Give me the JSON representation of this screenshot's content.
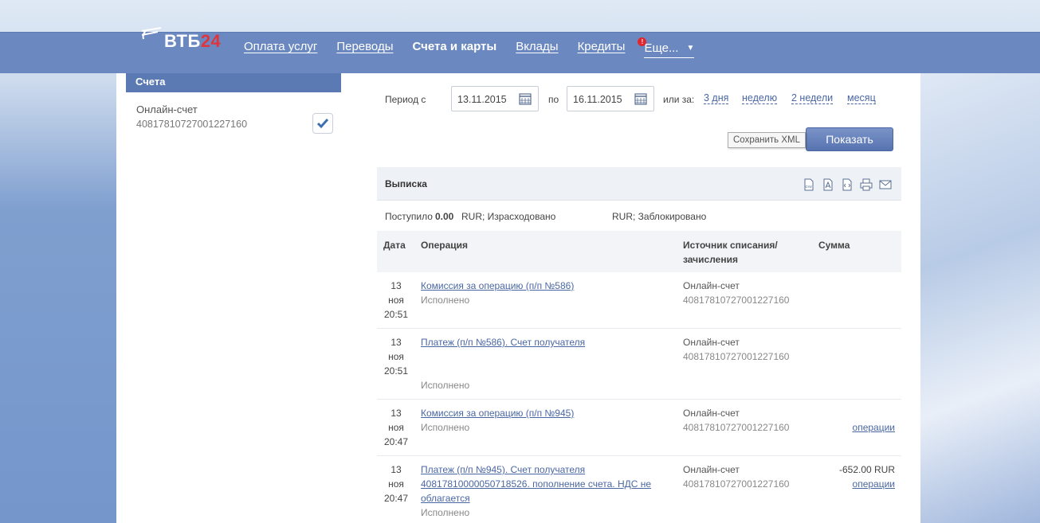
{
  "header": {
    "logo_text": "ВТБ",
    "logo_num": "24",
    "nav": [
      {
        "label": "Оплата услуг",
        "active": false
      },
      {
        "label": "Переводы",
        "active": false
      },
      {
        "label": "Счета и карты",
        "active": true
      },
      {
        "label": "Вклады",
        "active": false
      },
      {
        "label": "Кредиты",
        "active": false
      }
    ],
    "more_label": "Еще...",
    "more_badge": "!"
  },
  "sidebar": {
    "title": "Счета",
    "account_name": "Онлайн-счет",
    "account_number": "40817810727001227160",
    "checked": true
  },
  "filters": {
    "period_from_label": "Период с",
    "date_from": "13.11.2015",
    "to_label": "по",
    "date_to": "16.11.2015",
    "or_label": "или за:",
    "quick": [
      "3 дня",
      "неделю",
      "2 недели",
      "месяц"
    ],
    "show_button": "Показать"
  },
  "statement": {
    "title": "Выписка",
    "icons": [
      "csv-icon",
      "pdf-icon",
      "xml-icon",
      "print-icon",
      "mail-icon"
    ],
    "tooltip": "Сохранить XML",
    "summary": {
      "received_label": "Поступило",
      "received_value": "0.00",
      "received_currency": "RUR; Израсходовано",
      "spent_currency": "RUR; Заблокировано"
    },
    "columns": [
      "Дата",
      "Операция",
      "Источник списания/ зачисления",
      "Сумма"
    ],
    "rows": [
      {
        "day": "13",
        "month": "ноя",
        "time": "20:51",
        "operation": "Комиссия за операцию (п/п №586)",
        "status": "Исполнено",
        "source_name": "Онлайн-счет",
        "source_number": "40817810727001227160",
        "amount": "",
        "amount_link": ""
      },
      {
        "day": "13",
        "month": "ноя",
        "time": "20:51",
        "operation": "Платеж (п/п №586). Счет получателя",
        "status": "Исполнено",
        "source_name": "Онлайн-счет",
        "source_number": "40817810727001227160",
        "amount": "",
        "amount_link": ""
      },
      {
        "day": "13",
        "month": "ноя",
        "time": "20:47",
        "operation": "Комиссия за операцию (п/п №945)",
        "status": "Исполнено",
        "source_name": "Онлайн-счет",
        "source_number": "40817810727001227160",
        "amount": "",
        "amount_link": "операции"
      },
      {
        "day": "13",
        "month": "ноя",
        "time": "20:47",
        "operation": "Платеж (п/п №945). Счет получателя 40817810000050718526. пополнение счета. НДС не облагается",
        "status": "Исполнено",
        "source_name": "Онлайн-счет",
        "source_number": "40817810727001227160",
        "amount": "-652.00  RUR",
        "amount_link": "операции"
      }
    ]
  },
  "colors": {
    "nav_bg": "#6b89c0",
    "accent": "#5b79b3",
    "link": "#4a67a3",
    "logo_red": "#e2343c"
  }
}
